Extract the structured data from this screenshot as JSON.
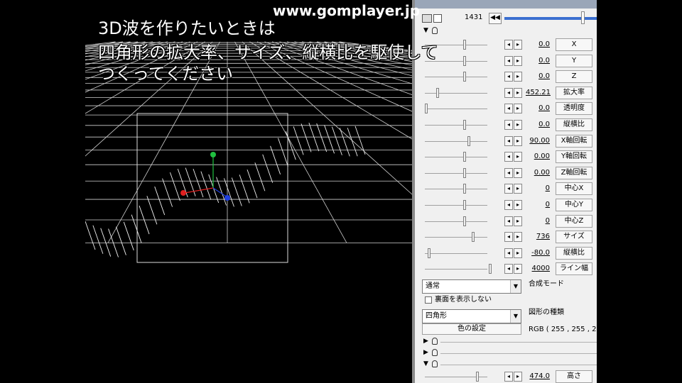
{
  "watermark": "www.gomplayer.jp",
  "caption": {
    "line1": "3D波を作りたいときは",
    "line2": "四角形の拡大率、サイズ、縦横比を駆使して",
    "line3": "つくってください"
  },
  "panel": {
    "frame_number": "1431",
    "params": [
      {
        "value": "0.0",
        "label": "X"
      },
      {
        "value": "0.0",
        "label": "Y"
      },
      {
        "value": "0.0",
        "label": "Z"
      },
      {
        "value": "452.21",
        "label": "拡大率"
      },
      {
        "value": "0.0",
        "label": "透明度"
      },
      {
        "value": "0.0",
        "label": "縦横比"
      },
      {
        "value": "90.00",
        "label": "X軸回転"
      },
      {
        "value": "0.00",
        "label": "Y軸回転"
      },
      {
        "value": "0.00",
        "label": "Z軸回転"
      },
      {
        "value": "0",
        "label": "中心X"
      },
      {
        "value": "0",
        "label": "中心Y"
      },
      {
        "value": "0",
        "label": "中心Z"
      },
      {
        "value": "736",
        "label": "サイズ"
      },
      {
        "value": "-80.0",
        "label": "縦横比"
      },
      {
        "value": "4000",
        "label": "ライン幅"
      }
    ],
    "blend_mode_value": "通常",
    "blend_mode_label": "合成モード",
    "backface_label": "裏面を表示しない",
    "shape_value": "四角形",
    "shape_label": "図形の種類",
    "color_button": "色の設定",
    "rgb_text": "RGB ( 255 , 255 , 2",
    "bottom_value": "474.0",
    "bottom_label": "高さ"
  },
  "colors": {
    "background": "#000000",
    "grid": "#ffffff",
    "panel_bg": "#f0f0f0",
    "gizmo_red": "#e02020",
    "gizmo_green": "#20c040",
    "gizmo_blue": "#2040e0",
    "accent_blue": "#3a6fd0"
  }
}
